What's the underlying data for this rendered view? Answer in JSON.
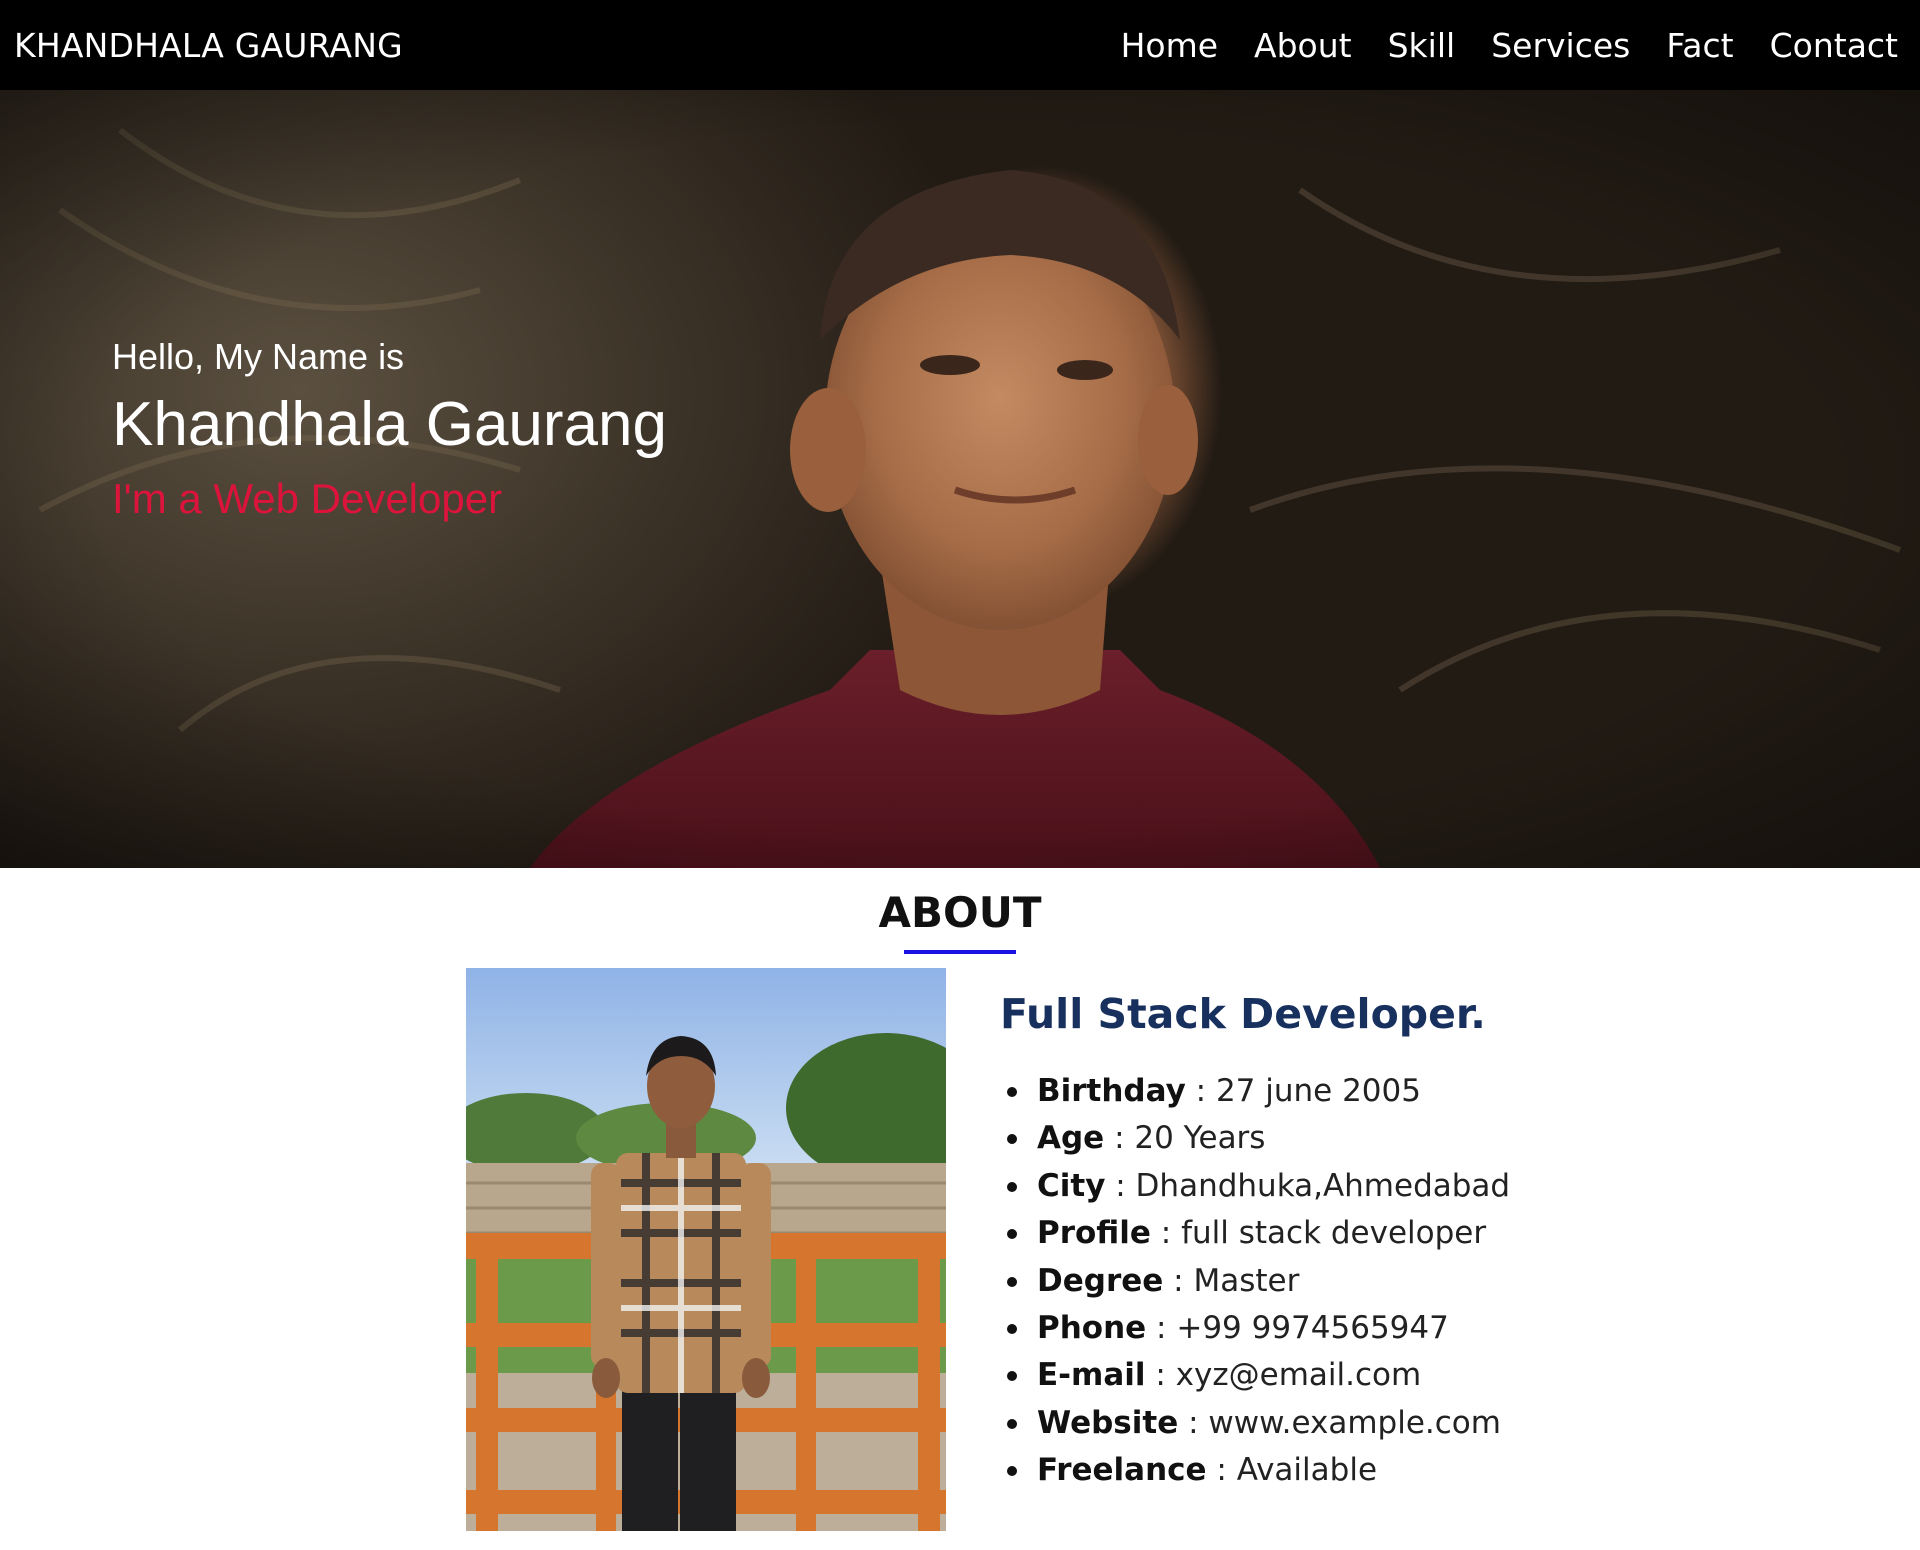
{
  "navbar": {
    "brand": "KHANDHALA GAURANG",
    "links": [
      "Home",
      "About",
      "Skill",
      "Services",
      "Fact",
      "Contact"
    ]
  },
  "hero": {
    "greeting": "Hello, My Name is",
    "name": "Khandhala Gaurang",
    "role": "I'm a Web Developer",
    "role_color": "#dc143c"
  },
  "about": {
    "title": "ABOUT",
    "underline_color": "#1a12e0",
    "heading": "Full Stack Developer.",
    "heading_color": "#17305e",
    "details": [
      {
        "label": "Birthday",
        "value": " : 27 june 2005"
      },
      {
        "label": "Age",
        "value": " : 20 Years"
      },
      {
        "label": "City",
        "value": " : Dhandhuka,Ahmedabad"
      },
      {
        "label": "Profile",
        "value": " : full stack developer"
      },
      {
        "label": "Degree",
        "value": " : Master"
      },
      {
        "label": "Phone",
        "value": " : +99 9974565947"
      },
      {
        "label": "E-mail",
        "value": " : xyz@email.com"
      },
      {
        "label": "Website",
        "value": " : www.example.com"
      },
      {
        "label": "Freelance",
        "value": " : Available"
      }
    ]
  }
}
